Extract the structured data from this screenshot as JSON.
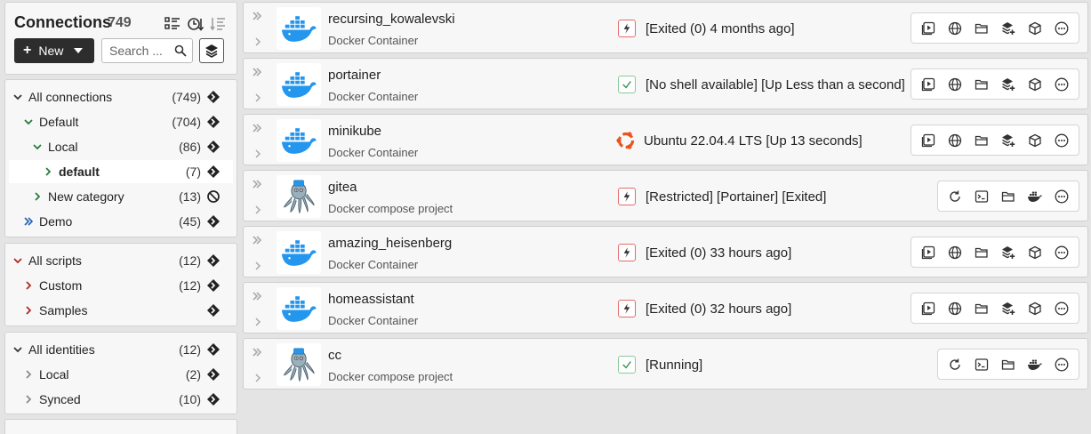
{
  "sidebar": {
    "title": "Connections",
    "count": "749",
    "new_label": "New",
    "search_placeholder": "Search ...",
    "connections": [
      {
        "label": "All connections",
        "count": "(749)",
        "expanded": true
      },
      {
        "label": "Default",
        "count": "(704)",
        "expanded": true
      },
      {
        "label": "Local",
        "count": "(86)",
        "expanded": true
      },
      {
        "label": "default",
        "count": "(7)",
        "selected": true
      },
      {
        "label": "New category",
        "count": "(13)",
        "action_icon": "prohibited-icon"
      },
      {
        "label": "Demo",
        "count": "(45)"
      }
    ],
    "scripts": [
      {
        "label": "All scripts",
        "count": "(12)",
        "expanded": true
      },
      {
        "label": "Custom",
        "count": "(12)"
      },
      {
        "label": "Samples",
        "count": ""
      }
    ],
    "identities": [
      {
        "label": "All identities",
        "count": "(12)",
        "expanded": true
      },
      {
        "label": "Local",
        "count": "(2)"
      },
      {
        "label": "Synced",
        "count": "(10)"
      }
    ]
  },
  "connections": [
    {
      "name": "recursing_kowalevski",
      "type": "Docker Container",
      "icon": "docker-whale-icon",
      "status_icon": "bolt-icon",
      "status": "[Exited (0) 4 months ago]",
      "actions": "container"
    },
    {
      "name": "portainer",
      "type": "Docker Container",
      "icon": "docker-whale-icon",
      "status_icon": "check-icon",
      "status": "[No shell available] [Up Less than a second]",
      "actions": "container"
    },
    {
      "name": "minikube",
      "type": "Docker Container",
      "icon": "docker-whale-icon",
      "status_icon": "ubuntu-icon",
      "status": "Ubuntu 22.04.4 LTS [Up 13 seconds]",
      "actions": "container"
    },
    {
      "name": "gitea",
      "type": "Docker compose project",
      "icon": "octopus-icon",
      "status_icon": "bolt-icon",
      "status": "[Restricted] [Portainer] [Exited]",
      "actions": "compose"
    },
    {
      "name": "amazing_heisenberg",
      "type": "Docker Container",
      "icon": "docker-whale-icon",
      "status_icon": "bolt-icon",
      "status": "[Exited (0) 33 hours ago]",
      "actions": "container"
    },
    {
      "name": "homeassistant",
      "type": "Docker Container",
      "icon": "docker-whale-icon",
      "status_icon": "bolt-icon",
      "status": "[Exited (0) 32 hours ago]",
      "actions": "container"
    },
    {
      "name": "cc",
      "type": "Docker compose project",
      "icon": "octopus-icon",
      "status_icon": "check-icon",
      "status": "[Running]",
      "actions": "compose"
    }
  ],
  "colors": {
    "docker_blue": "#2496ed",
    "warn_red": "#e36a6a",
    "ok_green": "#8ac99a",
    "ubuntu_orange": "#e95420",
    "chevron_green": "#1f7a3a",
    "chevron_red": "#b22222",
    "chevron_blue": "#1e5fb4"
  }
}
